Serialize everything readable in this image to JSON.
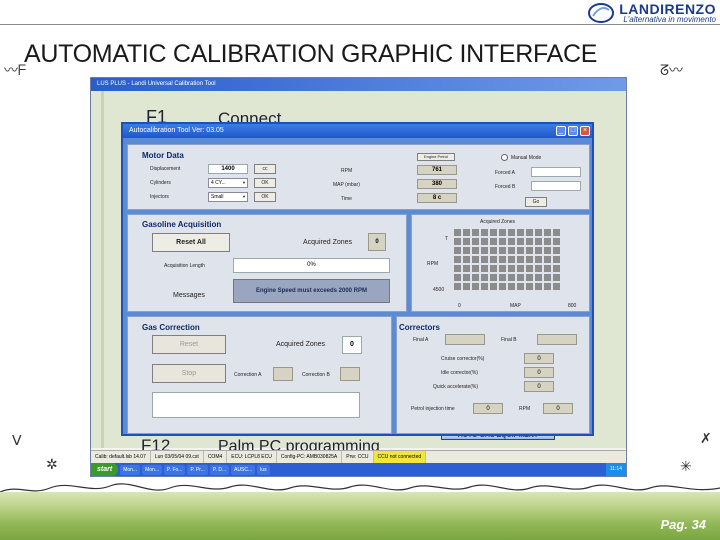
{
  "brand": {
    "name": "LANDIRENZO",
    "tagline": "L'alternativa in movimento",
    "color": "#1a3a8a"
  },
  "slide": {
    "title": "AUTOMATIC CALIBRATION GRAPHIC INTERFACE",
    "page": "Pag. 34"
  },
  "app": {
    "title": "LUS PLUS - Landi Universal Calibration Tool",
    "items": {
      "f1": "F1",
      "connect": "Connect",
      "f12": "F12",
      "palm": "Palm PC programming"
    },
    "statusbar": [
      "Calib: default.lsb 14.07",
      "Lun 03/05/04 09.cst",
      "COM4",
      "ECU: LCPL8 ECU",
      "Config-PC: AMB030825A",
      "Prw: CCU",
      "CCU not connected"
    ],
    "taskbar": {
      "start": "start",
      "items": [
        "Mon...",
        "Mon...",
        "P. Fo...",
        "P. Pr...",
        "P. D...",
        "AUSC...",
        "lus"
      ],
      "clock": "11:14"
    },
    "auto_gas_equipment": "AUTO GAS EQUIPMENT"
  },
  "dialog": {
    "title": "Autocalibration Tool Ver: 03.05",
    "motor": {
      "title": "Motor Data",
      "displacement_label": "Displacement",
      "displacement_value": "1400",
      "cylinders_label": "Cylinders",
      "cylinders_value": "4 CY...",
      "injectors_label": "Injectors",
      "injectors_value": "Small",
      "small_btn": "cc",
      "ok_btn": "OK",
      "ok_btn2": "OK",
      "engine_petrol": "Engine Petrol",
      "rpm_label": "RPM",
      "rpm_value": "761",
      "map_label": "MAP (mbar)",
      "map_value": "380",
      "time_label": "Time",
      "time_value": "8 c",
      "manual_mode": "Manual Mode",
      "forced_a": "Forced A",
      "forced_b": "Forced B",
      "go_btn": "Go"
    },
    "gasoline": {
      "title": "Gasoline Acquisition",
      "reset_all": "Reset All",
      "acquired_zones_label": "Acquired Zones",
      "acquired_zones_value": "0",
      "acq_length_label": "Acquisition Length",
      "acq_length_value": "0%",
      "messages_label": "Messages",
      "message": "Engine Speed must exceeds 2000 RPM",
      "zones_title": "Acquired Zones",
      "zones_y_top": "T",
      "zones_y_mid": "RPM",
      "zones_y_bot": "4500",
      "zones_x_left": "0",
      "zones_x_mid": "MAP",
      "zones_x_right": "800"
    },
    "gas": {
      "title": "Gas Correction",
      "reset": "Reset",
      "acquired_zones_label": "Acquired Zones",
      "acquired_zones_value": "0",
      "stop": "Stop",
      "correct_a": "Correction A",
      "correct_b": "Correction B"
    },
    "correctors": {
      "title": "Correctors",
      "final_a": "Final A",
      "final_b": "Final B",
      "cruise_label": "Cruise corrector(%)",
      "cruise_value": "0",
      "idle_label": "Idle corrector(%)",
      "idle_value": "0",
      "quick_label": "Quick accelerate(%)",
      "quick_value": "0",
      "petrol_time_label": "Petrol injection time",
      "petrol_time_value": "0",
      "rpm_label": "RPM",
      "rpm_value": "0"
    }
  }
}
